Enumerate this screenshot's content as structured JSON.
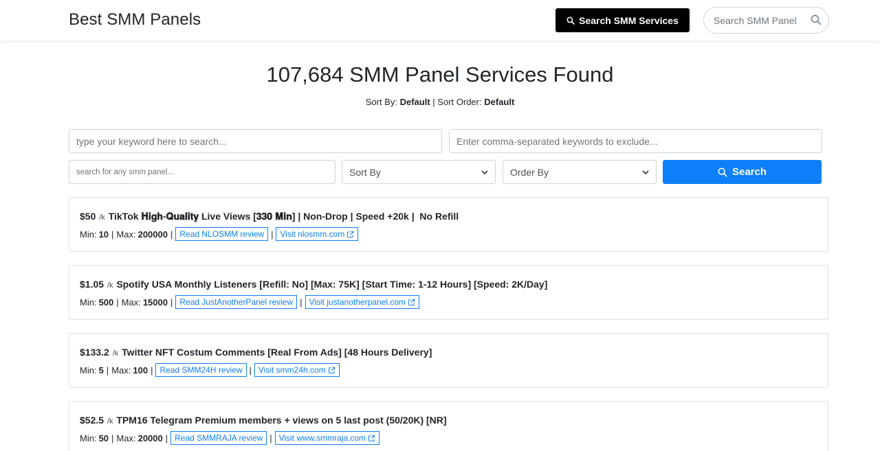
{
  "header": {
    "brand": "Best SMM Panels",
    "search_services_label": "Search SMM Services",
    "search_panel_placeholder": "Search SMM Panel"
  },
  "main": {
    "title": "107,684 SMM Panel Services Found",
    "sort_by_label": "Sort By:",
    "sort_by_value": "Default",
    "sort_order_label": "Sort Order:",
    "sort_order_value": "Default"
  },
  "filters": {
    "keyword_placeholder": "type your keyword here to search...",
    "exclude_placeholder": "Enter comma-separated keywords to exclude...",
    "panel_placeholder": "search for any smm panel...",
    "sort_by_select": "Sort By",
    "order_by_select": "Order By",
    "search_button": "Search"
  },
  "services": [
    {
      "price": "$50",
      "per": "/k",
      "name": "TikTok 𝐇𝐢𝐠𝐡-𝐐𝐮𝐚𝐥𝐢𝐭𝐲 Live Views [𝟑𝟑𝟎 𝐌𝐢𝐧] | Non-Drop | Speed +20k | ️ No Refill",
      "min": "10",
      "max": "200000",
      "review_label": "Read NLOSMM review",
      "visit_label": "Visit nlosmm.com"
    },
    {
      "price": "$1.05",
      "per": "/k",
      "name": "Spotify USA Monthly Listeners [Refill: No] [Max: 75K] [Start Time: 1-12 Hours] [Speed: 2K/Day]",
      "min": "500",
      "max": "15000",
      "review_label": "Read JustAnotherPanel review",
      "visit_label": "Visit justanotherpanel.com"
    },
    {
      "price": "$133.2",
      "per": "/k",
      "name": "Twitter NFT Costum Comments [Real From Ads] [48 Hours Delivery]",
      "min": "5",
      "max": "100",
      "review_label": "Read SMM24H review",
      "visit_label": "Visit smm24h.com"
    },
    {
      "price": "$52.5",
      "per": "/k",
      "name": "TPM16 Telegram Premium members + views on 5 last post (50/20K) [NR]",
      "min": "50",
      "max": "20000",
      "review_label": "Read SMMRAJA review",
      "visit_label": "Visit www.smmraja.com"
    }
  ],
  "labels": {
    "min": "Min:",
    "max": "Max:",
    "divider": "|"
  },
  "icons": {
    "search": "search-icon",
    "chevron": "chevron-down-icon",
    "external": "external-link-icon"
  },
  "colors": {
    "accent": "#0d7ff8",
    "dark_button": "#000000"
  }
}
